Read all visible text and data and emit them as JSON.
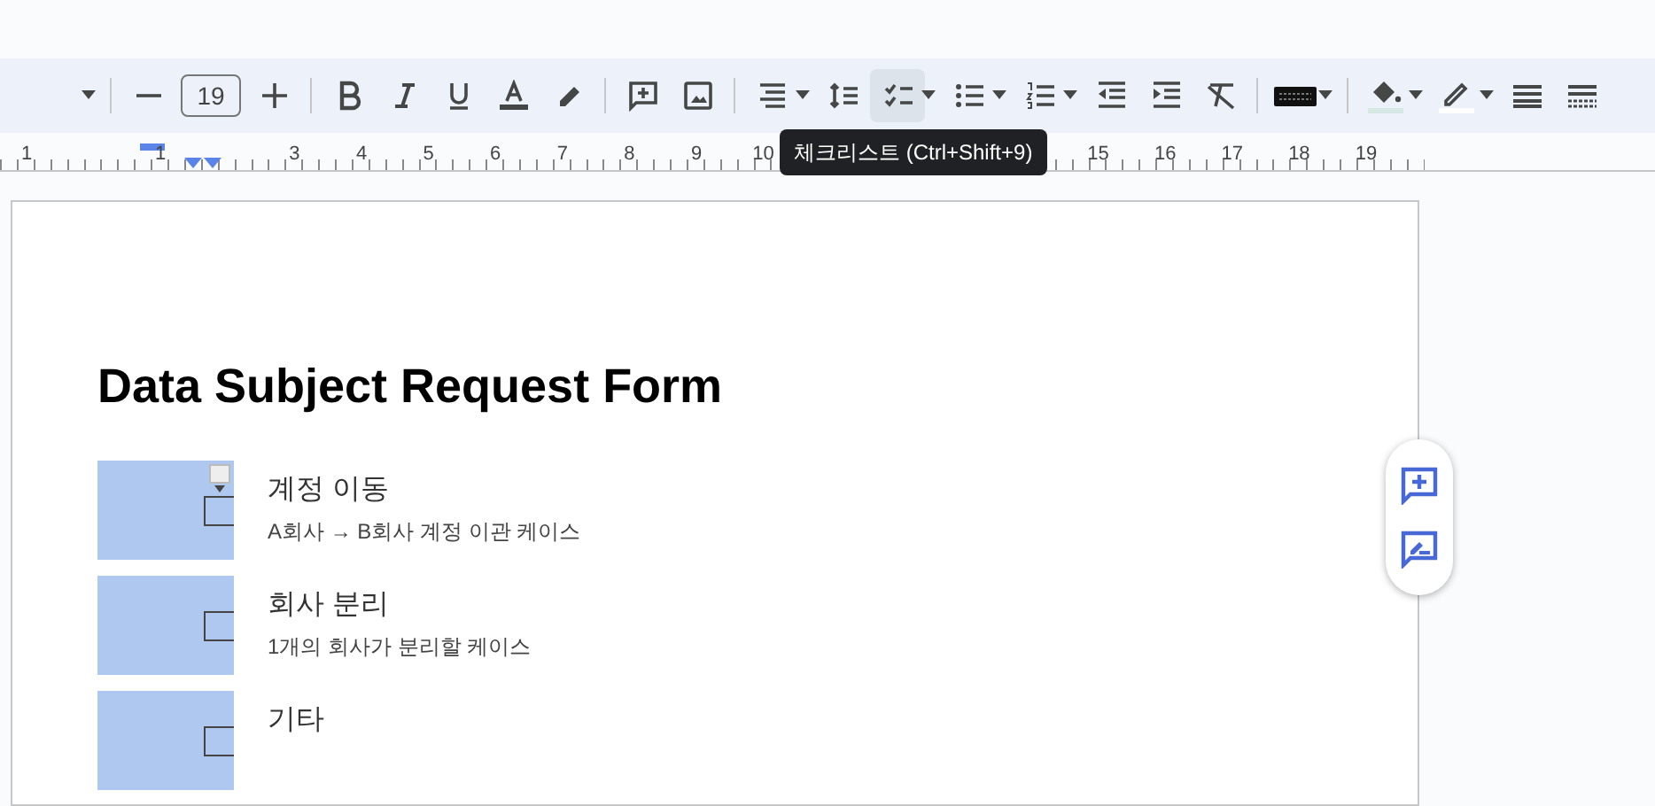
{
  "toolbar": {
    "font_size": "19",
    "buttons": [
      {
        "kind": "caret",
        "selected": false
      },
      {
        "kind": "sep"
      },
      {
        "kind": "minus",
        "selected": false
      },
      {
        "kind": "size"
      },
      {
        "kind": "plus",
        "selected": false
      },
      {
        "kind": "sep"
      },
      {
        "kind": "bold",
        "selected": false
      },
      {
        "kind": "italic",
        "selected": false
      },
      {
        "kind": "underline",
        "selected": false
      },
      {
        "kind": "textcolor",
        "selected": false
      },
      {
        "kind": "highlight",
        "selected": false
      },
      {
        "kind": "sep"
      },
      {
        "kind": "comment",
        "selected": false
      },
      {
        "kind": "image",
        "selected": false
      },
      {
        "kind": "sep"
      },
      {
        "kind": "align",
        "selected": false
      },
      {
        "kind": "caret",
        "selected": false
      },
      {
        "kind": "linespacing",
        "selected": false
      },
      {
        "kind": "checklist",
        "selected": true
      },
      {
        "kind": "caret",
        "selected": false
      },
      {
        "kind": "bullets",
        "selected": false
      },
      {
        "kind": "caret",
        "selected": false
      },
      {
        "kind": "numbered",
        "selected": false
      },
      {
        "kind": "caret",
        "selected": false
      },
      {
        "kind": "outdent",
        "selected": false
      },
      {
        "kind": "indent",
        "selected": false
      },
      {
        "kind": "clearformat",
        "selected": false
      },
      {
        "kind": "sep"
      },
      {
        "kind": "keyboard",
        "selected": false
      },
      {
        "kind": "caret",
        "selected": false
      },
      {
        "kind": "sep"
      },
      {
        "kind": "fill",
        "selected": false
      },
      {
        "kind": "caret",
        "selected": false
      },
      {
        "kind": "pen",
        "selected": false
      },
      {
        "kind": "caret",
        "selected": false
      },
      {
        "kind": "border",
        "selected": false
      },
      {
        "kind": "dash",
        "selected": false
      }
    ]
  },
  "ruler": {
    "labels": [
      "1",
      "1",
      "3",
      "4",
      "5",
      "6",
      "7",
      "8",
      "9",
      "10",
      "15",
      "16",
      "17",
      "18",
      "19"
    ]
  },
  "tooltip": "체크리스트 (Ctrl+Shift+9)",
  "document": {
    "title": "Data Subject Request Form",
    "items": [
      {
        "label": "계정 이동",
        "description": "A회사 → B회사 계정 이관 케이스",
        "checked": false,
        "menu": true
      },
      {
        "label": "회사 분리",
        "description": "1개의 회사가 분리할 케이스",
        "checked": false,
        "menu": false
      },
      {
        "label": "기타",
        "checked": false,
        "menu": false
      }
    ]
  }
}
